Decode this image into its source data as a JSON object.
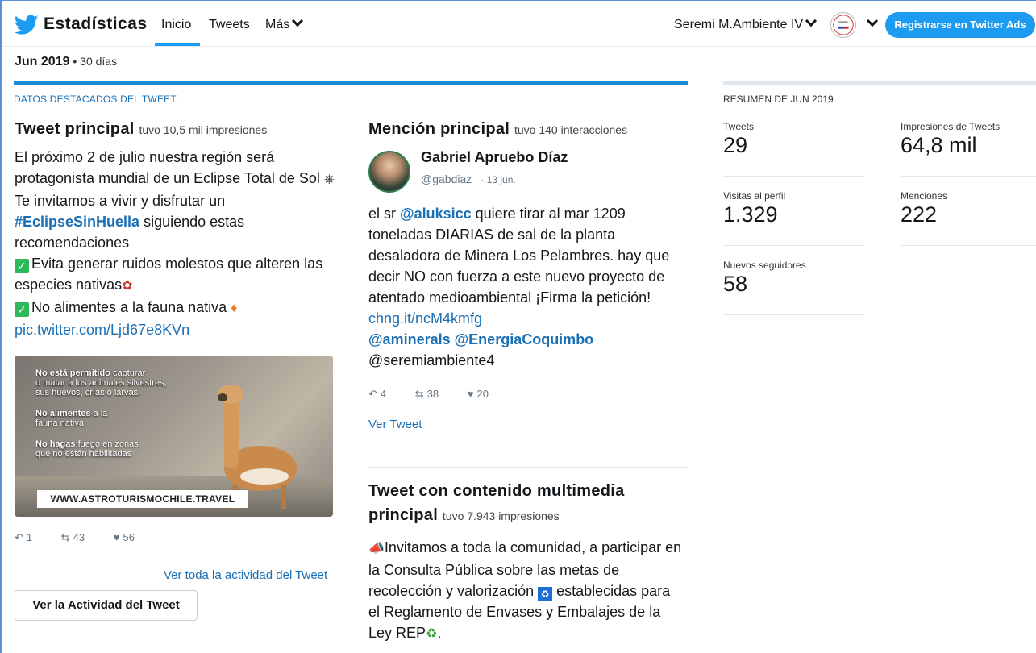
{
  "nav": {
    "brand": "Estadísticas",
    "links": [
      "Inicio",
      "Tweets",
      "Más"
    ],
    "account": "Seremi M.Ambiente IV",
    "ads_button": "Registrarse en Twitter Ads",
    "accent": "#1d9bf0"
  },
  "period": {
    "month": "Jun 2019",
    "separator": " • ",
    "days": "30 días"
  },
  "highlights": {
    "title": "DATOS DESTACADOS DEL TWEET",
    "top_tweet": {
      "heading": "Tweet principal",
      "meta": "tuvo 10,5 mil impresiones",
      "line1": "El próximo 2 de julio nuestra región será protagonista mundial de un Eclipse Total de Sol ",
      "line2": "Te invitamos a vivir y disfrutar un ",
      "hashtag": "#EclipseSinHuella",
      "line3": " siguiendo estas recomendaciones",
      "item1": "Evita generar ruidos molestos que alteren las especies nativas",
      "item2": "No alimentes a la fauna nativa ",
      "pic_link": "pic.twitter.com/Ljd67e8KVn",
      "media": {
        "t1_bold": "No está permitido",
        "t1_rest": " capturar",
        "t1_l2": "o matar a los animales silvestres,",
        "t1_l3": "sus huevos, crías o larvas.",
        "t2_bold": "No alimentes",
        "t2_rest": " a la",
        "t2_l2": "fauna nativa.",
        "t3_bold": "No hagas",
        "t3_rest": " fuego en zonas",
        "t3_l2": "que no están habilitadas",
        "url": "WWW.ASTROTURISMOCHILE.TRAVEL"
      },
      "replies": "1",
      "retweets": "43",
      "likes": "56",
      "see_all": "Ver toda la actividad del Tweet",
      "button": "Ver la Actividad del Tweet"
    },
    "top_mention": {
      "heading": "Mención principal",
      "meta": "tuvo 140 interacciones",
      "name": "Gabriel Apruebo Díaz",
      "handle": "@gabdiaz_",
      "date": " · 13 jun.",
      "t1": "el sr ",
      "m1": "@aluksicc",
      "t2": " quiere tirar al mar 1209 toneladas DIARIAS de sal de la planta desaladora de Minera Los Pelambres. hay que decir NO con fuerza a este nuevo proyecto de atentado medioambiental ¡Firma la petición! ",
      "link": "chng.it/ncM4kmfg",
      "m2": "@aminerals",
      "m3": "@EnergiaCoquimbo",
      "t3": "@seremiambiente4",
      "replies": "4",
      "retweets": "38",
      "likes": "20",
      "see_tweet": "Ver Tweet"
    },
    "top_media": {
      "heading1": "Tweet con contenido multimedia",
      "heading2": "principal",
      "meta": "tuvo 7.943 impresiones",
      "t1": "Invitamos a toda la comunidad, a participar en la Consulta Pública sobre las metas de recolección y valorización ",
      "t2": " establecidas para el Reglamento de Envases y Embalajes de la Ley REP",
      "t3": "."
    }
  },
  "summary": {
    "title": "RESUMEN DE JUN 2019",
    "tweets_label": "Tweets",
    "tweets_value": "29",
    "impressions_label": "Impresiones de Tweets",
    "impressions_value": "64,8 mil",
    "visits_label": "Visitas al perfil",
    "visits_value": "1.329",
    "mentions_label": "Menciones",
    "mentions_value": "222",
    "followers_label": "Nuevos seguidores",
    "followers_value": "58"
  }
}
